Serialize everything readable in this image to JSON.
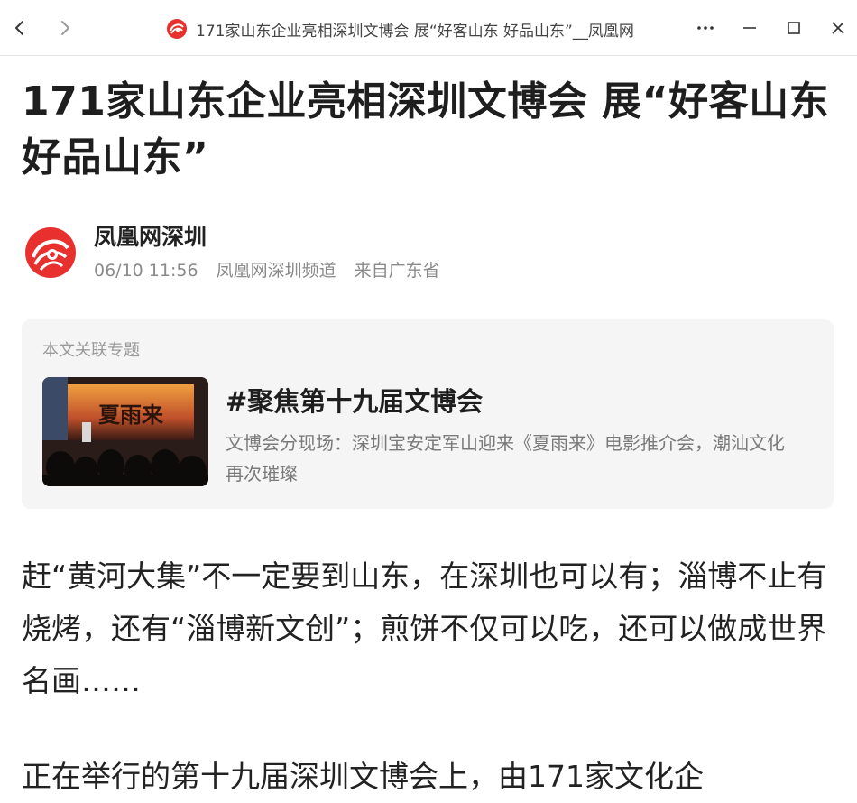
{
  "window": {
    "tab_title": "171家山东企业亮相深圳文博会 展“好客山东 好品山东”__凤凰网"
  },
  "article": {
    "title": "171家山东企业亮相深圳文博会 展“好客山东 好品山东”",
    "author": {
      "name": "凤凰网深圳",
      "time": "06/10 11:56",
      "channel": "凤凰网深圳频道",
      "location": "来自广东省"
    },
    "related_topic": {
      "label": "本文关联专题",
      "heading": "#聚焦第十九届文博会",
      "description": "文博会分现场：深圳宝安定军山迎来《夏雨来》电影推介会，潮汕文化再次璀璨",
      "thumbnail_text": "夏雨来"
    },
    "paragraphs": [
      "赶“黄河大集”不一定要到山东，在深圳也可以有；淄博不止有烧烤，还有“淄博新文创”；煎饼不仅可以吃，还可以做成世界名画……",
      "正在举行的第十九届深圳文博会上，由171家文化企"
    ]
  },
  "icons": {
    "back": "chevron-left-icon",
    "forward": "chevron-right-icon",
    "site_logo": "ifeng-logo-icon",
    "more": "more-horizontal-icon",
    "minimize": "minimize-icon",
    "maximize": "maximize-icon",
    "close": "close-icon"
  },
  "colors": {
    "brand_red": "#e8312f",
    "title_text": "#1e1e1e",
    "meta_text": "#8a8a8a",
    "card_bg": "#f5f5f5"
  }
}
